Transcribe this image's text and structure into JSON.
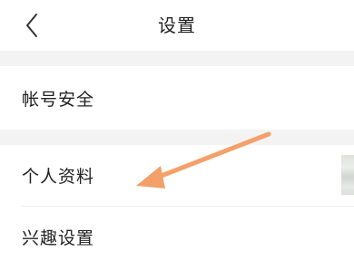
{
  "header": {
    "title": "设置",
    "back_icon": "chevron-left-icon"
  },
  "settings": {
    "items": [
      {
        "label": "帐号安全"
      },
      {
        "label": "个人资料"
      },
      {
        "label": "兴趣设置"
      }
    ]
  },
  "colors": {
    "section_gap": "#f3f3f3",
    "annotation_arrow": "#f4a06a",
    "text": "#222222"
  }
}
